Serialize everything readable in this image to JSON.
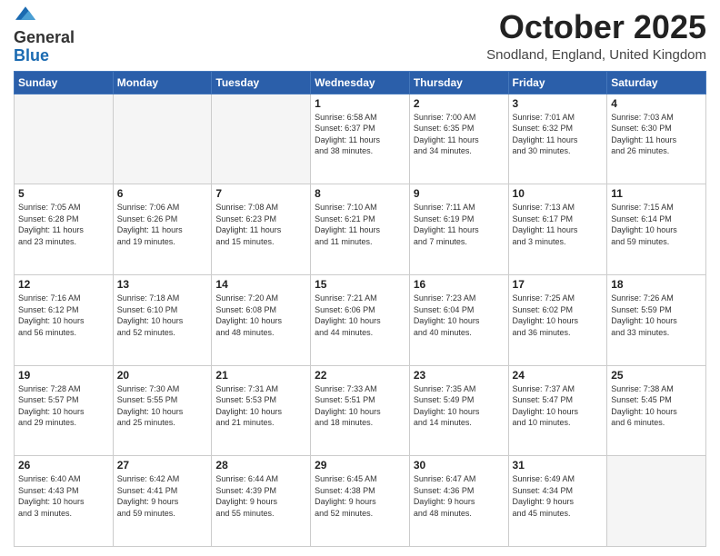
{
  "logo": {
    "general": "General",
    "blue": "Blue"
  },
  "header": {
    "month": "October 2025",
    "location": "Snodland, England, United Kingdom"
  },
  "weekdays": [
    "Sunday",
    "Monday",
    "Tuesday",
    "Wednesday",
    "Thursday",
    "Friday",
    "Saturday"
  ],
  "weeks": [
    [
      {
        "day": "",
        "info": ""
      },
      {
        "day": "",
        "info": ""
      },
      {
        "day": "",
        "info": ""
      },
      {
        "day": "1",
        "info": "Sunrise: 6:58 AM\nSunset: 6:37 PM\nDaylight: 11 hours\nand 38 minutes."
      },
      {
        "day": "2",
        "info": "Sunrise: 7:00 AM\nSunset: 6:35 PM\nDaylight: 11 hours\nand 34 minutes."
      },
      {
        "day": "3",
        "info": "Sunrise: 7:01 AM\nSunset: 6:32 PM\nDaylight: 11 hours\nand 30 minutes."
      },
      {
        "day": "4",
        "info": "Sunrise: 7:03 AM\nSunset: 6:30 PM\nDaylight: 11 hours\nand 26 minutes."
      }
    ],
    [
      {
        "day": "5",
        "info": "Sunrise: 7:05 AM\nSunset: 6:28 PM\nDaylight: 11 hours\nand 23 minutes."
      },
      {
        "day": "6",
        "info": "Sunrise: 7:06 AM\nSunset: 6:26 PM\nDaylight: 11 hours\nand 19 minutes."
      },
      {
        "day": "7",
        "info": "Sunrise: 7:08 AM\nSunset: 6:23 PM\nDaylight: 11 hours\nand 15 minutes."
      },
      {
        "day": "8",
        "info": "Sunrise: 7:10 AM\nSunset: 6:21 PM\nDaylight: 11 hours\nand 11 minutes."
      },
      {
        "day": "9",
        "info": "Sunrise: 7:11 AM\nSunset: 6:19 PM\nDaylight: 11 hours\nand 7 minutes."
      },
      {
        "day": "10",
        "info": "Sunrise: 7:13 AM\nSunset: 6:17 PM\nDaylight: 11 hours\nand 3 minutes."
      },
      {
        "day": "11",
        "info": "Sunrise: 7:15 AM\nSunset: 6:14 PM\nDaylight: 10 hours\nand 59 minutes."
      }
    ],
    [
      {
        "day": "12",
        "info": "Sunrise: 7:16 AM\nSunset: 6:12 PM\nDaylight: 10 hours\nand 56 minutes."
      },
      {
        "day": "13",
        "info": "Sunrise: 7:18 AM\nSunset: 6:10 PM\nDaylight: 10 hours\nand 52 minutes."
      },
      {
        "day": "14",
        "info": "Sunrise: 7:20 AM\nSunset: 6:08 PM\nDaylight: 10 hours\nand 48 minutes."
      },
      {
        "day": "15",
        "info": "Sunrise: 7:21 AM\nSunset: 6:06 PM\nDaylight: 10 hours\nand 44 minutes."
      },
      {
        "day": "16",
        "info": "Sunrise: 7:23 AM\nSunset: 6:04 PM\nDaylight: 10 hours\nand 40 minutes."
      },
      {
        "day": "17",
        "info": "Sunrise: 7:25 AM\nSunset: 6:02 PM\nDaylight: 10 hours\nand 36 minutes."
      },
      {
        "day": "18",
        "info": "Sunrise: 7:26 AM\nSunset: 5:59 PM\nDaylight: 10 hours\nand 33 minutes."
      }
    ],
    [
      {
        "day": "19",
        "info": "Sunrise: 7:28 AM\nSunset: 5:57 PM\nDaylight: 10 hours\nand 29 minutes."
      },
      {
        "day": "20",
        "info": "Sunrise: 7:30 AM\nSunset: 5:55 PM\nDaylight: 10 hours\nand 25 minutes."
      },
      {
        "day": "21",
        "info": "Sunrise: 7:31 AM\nSunset: 5:53 PM\nDaylight: 10 hours\nand 21 minutes."
      },
      {
        "day": "22",
        "info": "Sunrise: 7:33 AM\nSunset: 5:51 PM\nDaylight: 10 hours\nand 18 minutes."
      },
      {
        "day": "23",
        "info": "Sunrise: 7:35 AM\nSunset: 5:49 PM\nDaylight: 10 hours\nand 14 minutes."
      },
      {
        "day": "24",
        "info": "Sunrise: 7:37 AM\nSunset: 5:47 PM\nDaylight: 10 hours\nand 10 minutes."
      },
      {
        "day": "25",
        "info": "Sunrise: 7:38 AM\nSunset: 5:45 PM\nDaylight: 10 hours\nand 6 minutes."
      }
    ],
    [
      {
        "day": "26",
        "info": "Sunrise: 6:40 AM\nSunset: 4:43 PM\nDaylight: 10 hours\nand 3 minutes."
      },
      {
        "day": "27",
        "info": "Sunrise: 6:42 AM\nSunset: 4:41 PM\nDaylight: 9 hours\nand 59 minutes."
      },
      {
        "day": "28",
        "info": "Sunrise: 6:44 AM\nSunset: 4:39 PM\nDaylight: 9 hours\nand 55 minutes."
      },
      {
        "day": "29",
        "info": "Sunrise: 6:45 AM\nSunset: 4:38 PM\nDaylight: 9 hours\nand 52 minutes."
      },
      {
        "day": "30",
        "info": "Sunrise: 6:47 AM\nSunset: 4:36 PM\nDaylight: 9 hours\nand 48 minutes."
      },
      {
        "day": "31",
        "info": "Sunrise: 6:49 AM\nSunset: 4:34 PM\nDaylight: 9 hours\nand 45 minutes."
      },
      {
        "day": "",
        "info": ""
      }
    ]
  ]
}
